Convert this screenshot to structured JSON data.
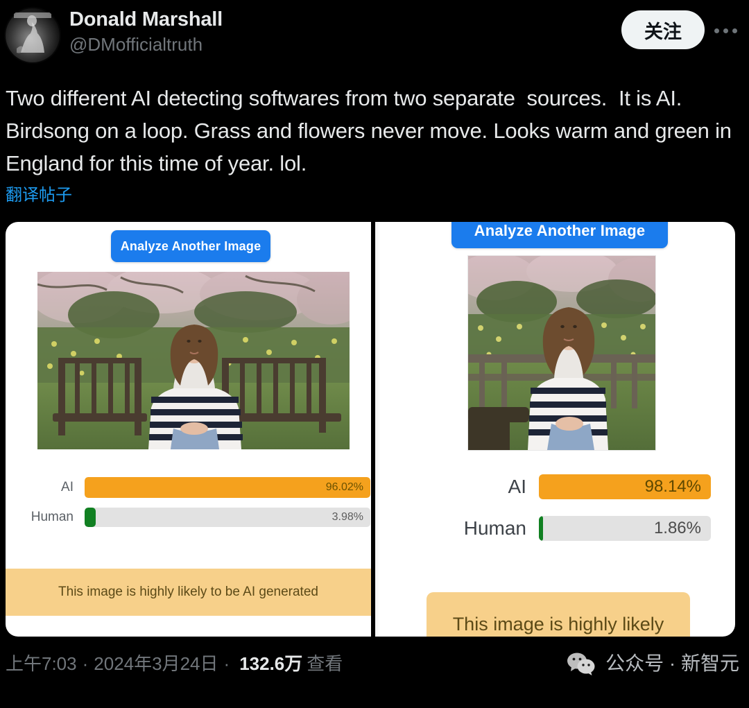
{
  "post": {
    "display_name": "Donald Marshall",
    "handle": "@DMofficialtruth",
    "avatar_icon": "avatar-image",
    "follow_label": "关注",
    "more_icon": "more-options-icon",
    "text": "Two different AI detecting softwares from two separate  sources.  It is AI.  Birdsong on a loop. Grass and flowers never move. Looks warm and green in England for this time of year. lol.",
    "translate_label": "翻译帖子"
  },
  "media": {
    "left_panel": {
      "analyze_button_label": "Analyze Another Image",
      "photo_alt": "woman-on-park-bench-photo",
      "results": [
        {
          "label": "AI",
          "percent": "96.02%",
          "value": 96.02,
          "color": "#f5a11d"
        },
        {
          "label": "Human",
          "percent": "3.98%",
          "value": 3.98,
          "color": "#118022"
        }
      ],
      "verdict": "This image is highly likely to be AI generated"
    },
    "right_panel": {
      "analyze_button_label": "Analyze Another Image",
      "photo_alt": "woman-on-park-bench-photo",
      "results": [
        {
          "label": "AI",
          "percent": "98.14%",
          "value": 98.14,
          "color": "#f5a11d"
        },
        {
          "label": "Human",
          "percent": "1.86%",
          "value": 1.86,
          "color": "#118022"
        }
      ],
      "verdict": "This image is highly likely"
    }
  },
  "footer": {
    "time": "上午7:03",
    "separator": "·",
    "date": "2024年3月24日",
    "views_count": "132.6万",
    "views_label": "查看",
    "watermark_icon": "wechat-icon",
    "watermark_text": "公众号 · 新智元"
  },
  "colors": {
    "background": "#000000",
    "text_primary": "#e7e9ea",
    "text_secondary": "#71767b",
    "link": "#1d9bf0",
    "follow_bg": "#eff3f4",
    "button_blue": "#1b7ced",
    "bar_ai": "#f5a11d",
    "bar_human": "#118022",
    "bar_track": "#e2e2e2",
    "verdict_bg": "#f7d08a"
  }
}
